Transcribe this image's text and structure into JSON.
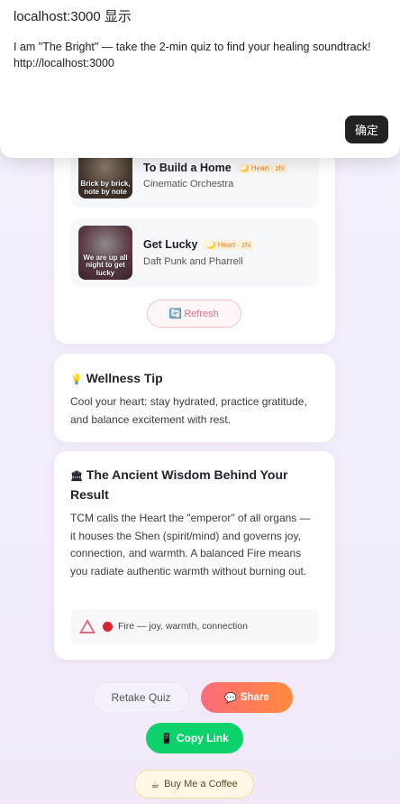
{
  "dialog": {
    "title": "localhost:3000 显示",
    "message": "I am \"The Bright\" — take the 2-min quiz to find your healing soundtrack!\nhttp://localhost:3000",
    "ok_label": "确定"
  },
  "songs": [
    {
      "title": "To Build a Home",
      "artist": "Cinematic Orchestra",
      "tag": "🌙 Heart · zhi",
      "cover_text": "Brick by brick, note by note"
    },
    {
      "title": "Get Lucky",
      "artist": "Daft Punk and Pharrell",
      "tag": "🌙 Heart · zhi",
      "cover_text": "We are up all night to get lucky"
    }
  ],
  "refresh_label": "Refresh",
  "refresh_icon": "🔄",
  "tip": {
    "icon": "💡",
    "heading": "Wellness Tip",
    "body": "Cool your heart: stay hydrated, practice gratitude, and balance excitement with rest."
  },
  "wisdom": {
    "icon": "🏛",
    "heading": "The Ancient Wisdom Behind Your Result",
    "body": "TCM calls the Heart the \"emperor\" of all organs — it houses the Shen (spirit/mind) and governs joy, connection, and warmth. A balanced Fire means you radiate authentic warmth without burning out.",
    "element_text": "Fire — joy, warmth, connection"
  },
  "buttons": {
    "retake": "Retake Quiz",
    "share": "Share",
    "share_icon": "💬",
    "copy": "Copy Link",
    "copy_icon": "📱",
    "coffee": "Buy Me a Coffee",
    "coffee_icon": "☕"
  },
  "colors": {
    "share_gradient_start": "#ff6b78",
    "share_gradient_end": "#ff8a3d",
    "copy_green": "#0dd16a",
    "refresh_pink": "#e36f8a",
    "fire_red": "#d7222f"
  }
}
